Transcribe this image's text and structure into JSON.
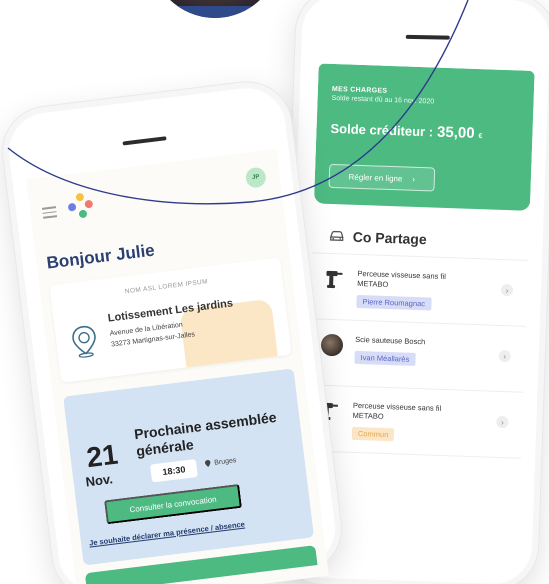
{
  "colors": {
    "green": "#4dba82",
    "navy": "#2a3f72",
    "curve": "#2e3a8c",
    "tag_blue": "#d8ddf7",
    "tag_orange": "#fbe7c7",
    "card_blue": "#d3e3f3"
  },
  "right_phone": {
    "charges": {
      "title": "MES CHARGES",
      "subtitle": "Solde restant dû au 16 nov. 2020",
      "balance_label": "Solde créditeur :",
      "balance_amount": "35,00",
      "balance_currency": "€",
      "pay_button": "Régler en ligne",
      "pay_chevron": "›"
    },
    "copartage": {
      "icon": "car-icon",
      "title": "Co Partage",
      "items": [
        {
          "name": "Perceuse visseuse sans fil METABO",
          "tag": "Pierre Roumagnac",
          "icon": "drill-icon"
        },
        {
          "name": "Scie sauteuse Bosch",
          "tag": "Ivan Méallarès",
          "icon": "user-photo"
        },
        {
          "name": "Perceuse visseuse sans fil METABO",
          "tag": "Commun",
          "icon": "drill-icon"
        }
      ],
      "chevron": "›"
    }
  },
  "left_phone": {
    "initials": "JP",
    "greeting": "Bonjour Julie",
    "lot_card": {
      "asl_label": "NOM ASL LOREM IPSUM",
      "name": "Lotissement Les jardins",
      "address_line1": "Avenue de la Libération",
      "address_line2": "33273 Martignas-sur-Jalles"
    },
    "ag_card": {
      "day": "21",
      "month": "Nov.",
      "title": "Prochaine assemblée générale",
      "time": "18:30",
      "place": "Bruges",
      "cta": "Consulter la convocation",
      "presence_link": "Je souhaite déclarer ma présence / absence"
    }
  }
}
